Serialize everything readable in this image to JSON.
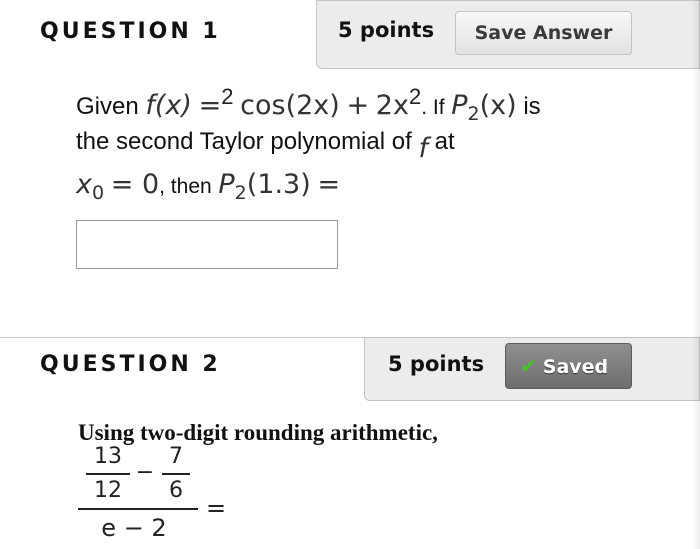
{
  "question1": {
    "title": "QUESTION 1",
    "points": "5 points",
    "save_label": "Save Answer",
    "text": {
      "given": "Given",
      "f_of_x": "f(x)",
      "eq": "=",
      "two": "2",
      "cos": "cos(2x)",
      "plus": "+",
      "two_x": "2x",
      "exp": "2",
      "dot_if": ". If",
      "P": "P",
      "sub2": "2",
      "of_x": "(x)",
      "is": "is",
      "line2": "the second Taylor polynomial of",
      "f": "f",
      "at": "at",
      "x": "x",
      "sub0": "0",
      "eq_zero": "= 0",
      "then": ", then",
      "P_at": "(1.3)",
      "eq_end": "="
    },
    "answer_value": ""
  },
  "question2": {
    "title": "QUESTION 2",
    "points": "5 points",
    "saved_label": "Saved",
    "text": "Using two-digit rounding arithmetic,",
    "expr": {
      "a_num": "13",
      "a_den": "12",
      "minus": "−",
      "b_num": "7",
      "b_den": "6",
      "denominator": "e − 2",
      "equals": "="
    }
  },
  "colors": {
    "panel": "#ececec",
    "saved_button": "#7a7a7a",
    "check": "#49c22a"
  },
  "icons": {
    "saved": "check-icon"
  }
}
